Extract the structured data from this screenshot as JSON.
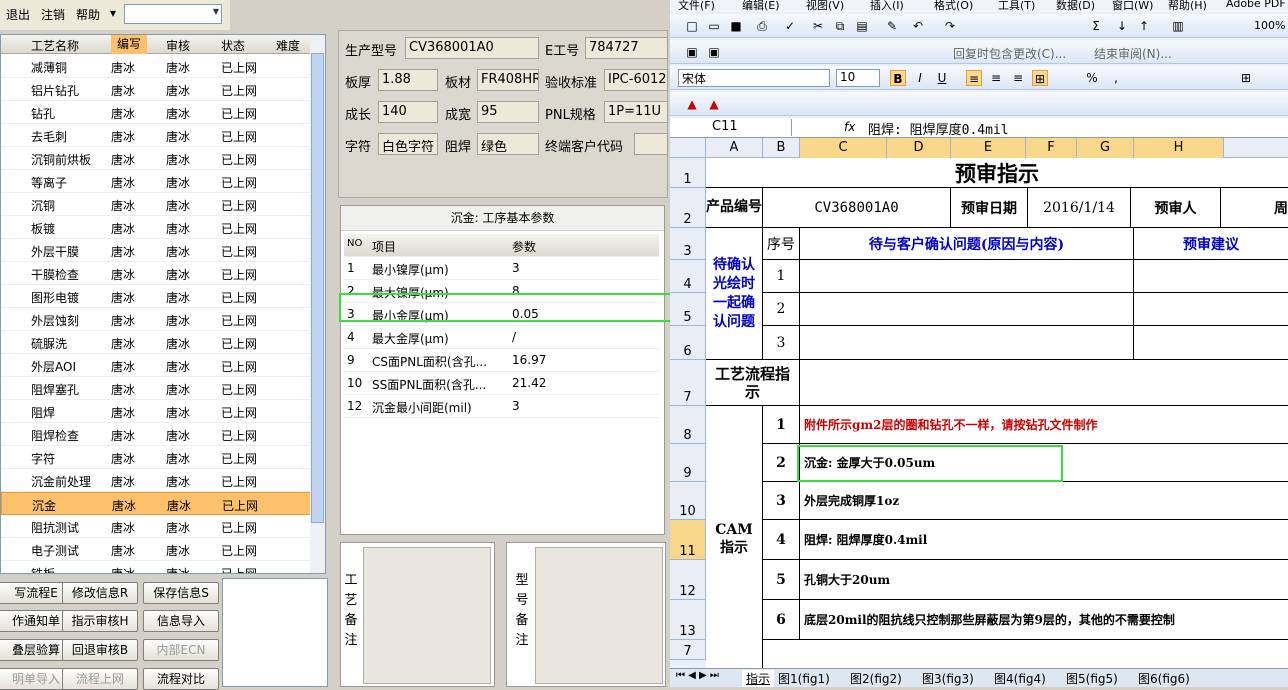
{
  "menubar": {
    "exit": "退出",
    "logout": "注销",
    "help": "帮助",
    "help_arrow": "▾"
  },
  "process_table": {
    "headers": [
      "工艺名称",
      "编写",
      "审核",
      "状态",
      "难度"
    ],
    "rows": [
      [
        "减薄铜",
        "唐冰",
        "唐冰",
        "已上网",
        ""
      ],
      [
        "铝片钻孔",
        "唐冰",
        "唐冰",
        "已上网",
        ""
      ],
      [
        "钻孔",
        "唐冰",
        "唐冰",
        "已上网",
        ""
      ],
      [
        "去毛刺",
        "唐冰",
        "唐冰",
        "已上网",
        ""
      ],
      [
        "沉铜前烘板",
        "唐冰",
        "唐冰",
        "已上网",
        ""
      ],
      [
        "等离子",
        "唐冰",
        "唐冰",
        "已上网",
        ""
      ],
      [
        "沉铜",
        "唐冰",
        "唐冰",
        "已上网",
        ""
      ],
      [
        "板镀",
        "唐冰",
        "唐冰",
        "已上网",
        ""
      ],
      [
        "外层干膜",
        "唐冰",
        "唐冰",
        "已上网",
        ""
      ],
      [
        "干膜检查",
        "唐冰",
        "唐冰",
        "已上网",
        ""
      ],
      [
        "图形电镀",
        "唐冰",
        "唐冰",
        "已上网",
        ""
      ],
      [
        "外层蚀刻",
        "唐冰",
        "唐冰",
        "已上网",
        ""
      ],
      [
        "硫脲洗",
        "唐冰",
        "唐冰",
        "已上网",
        ""
      ],
      [
        "外层AOI",
        "唐冰",
        "唐冰",
        "已上网",
        ""
      ],
      [
        "阻焊塞孔",
        "唐冰",
        "唐冰",
        "已上网",
        ""
      ],
      [
        "阻焊",
        "唐冰",
        "唐冰",
        "已上网",
        ""
      ],
      [
        "阻焊检查",
        "唐冰",
        "唐冰",
        "已上网",
        ""
      ],
      [
        "字符",
        "唐冰",
        "唐冰",
        "已上网",
        ""
      ],
      [
        "沉金前处理",
        "唐冰",
        "唐冰",
        "已上网",
        ""
      ],
      [
        "沉金",
        "唐冰",
        "唐冰",
        "已上网",
        ""
      ],
      [
        "阻抗测试",
        "唐冰",
        "唐冰",
        "已上网",
        ""
      ],
      [
        "电子测试",
        "唐冰",
        "唐冰",
        "已上网",
        ""
      ],
      [
        "铣板",
        "唐冰",
        "唐冰",
        "已上网",
        ""
      ]
    ],
    "selected_index": 19
  },
  "buttons": {
    "write_info": "写流程E",
    "modify_info": "修改信息R",
    "save_info": "保存信息S",
    "make_notice": "作通知单",
    "instruct_review": "指示审核H",
    "info_import": "信息导入",
    "layer_check": "叠层验算",
    "return_review": "回退审核B",
    "internal_ecn": "内部ECN",
    "list_import": "明单导入",
    "flow_online": "流程上网",
    "flow_compare": "流程对比"
  },
  "product": {
    "model_label": "生产型号",
    "model": "CV368001A0",
    "e_label": "E工号",
    "e_no": "784727",
    "thick_label": "板厚",
    "thick": "1.88",
    "material_label": "板材",
    "material": "FR408HR",
    "std_label": "验收标准",
    "std": "IPC-6012",
    "len_label": "成长",
    "len": "140",
    "wid_label": "成宽",
    "wid": "95",
    "pnl_label": "PNL规格",
    "pnl": "1P=11U",
    "char_label": "字符",
    "char": "白色字符",
    "mask_label": "阻焊",
    "mask": "绿色",
    "cust_label": "终端客户代码",
    "cust": ""
  },
  "params": {
    "title": "沉金: 工序基本参数",
    "headers": [
      "NO",
      "项目",
      "参数"
    ],
    "rows": [
      [
        "1",
        "最小镍厚(μm)",
        "3"
      ],
      [
        "2",
        "最大镍厚(μm)",
        "8"
      ],
      [
        "3",
        "最小金厚(μm)",
        "0.05"
      ],
      [
        "4",
        "最大金厚(μm)",
        "/"
      ],
      [
        "9",
        "CS面PNL面积(含孔...",
        "16.97"
      ],
      [
        "10",
        "SS面PNL面积(含孔...",
        "21.42"
      ],
      [
        "12",
        "沉金最小间距(mil)",
        "3"
      ]
    ]
  },
  "notes": {
    "process_note": "工艺备注",
    "model_note": "型号备注"
  },
  "excel": {
    "menu": [
      "文件(F)",
      "编辑(E)",
      "视图(V)",
      "插入(I)",
      "格式(O)",
      "工具(T)",
      "数据(D)",
      "窗口(W)",
      "帮助(H)",
      "Adobe PDF"
    ],
    "font": "宋体",
    "size": "10",
    "zoom": "100%",
    "review_text": "回复时包含更改(C)...",
    "end_review": "结束审阅(N)...",
    "cell_ref": "C11",
    "fx": "fx",
    "formula": "阻焊: 阻焊厚度0.4mil",
    "cols": [
      "A",
      "B",
      "C",
      "D",
      "E",
      "F",
      "G",
      "H"
    ],
    "rows": [
      "1",
      "2",
      "3",
      "4",
      "5",
      "6",
      "7",
      "8",
      "9",
      "10",
      "11",
      "12",
      "13",
      "7"
    ],
    "title": "预审指示",
    "product_no_label": "产品编号",
    "product_no": "CV368001A0",
    "review_date_label": "预审日期",
    "review_date": "2016/1/14",
    "reviewer_label": "预审人",
    "reviewer": "周",
    "seq_label": "序号",
    "issue_header": "待与客户确认问题(原因与内容)",
    "suggest_header": "预审建议",
    "pending_label": "待确认光绘时一起确认问题",
    "issue_nums": [
      "1",
      "2",
      "3"
    ],
    "process_flow_label": "工艺流程指示",
    "cam_label": "CAM指示",
    "cam_items": [
      {
        "n": "1",
        "text": "附件所示gm2层的圈和钻孔不一样，请按钻孔文件制作",
        "red": true
      },
      {
        "n": "2",
        "text": "沉金: 金厚大于0.05um",
        "red": false
      },
      {
        "n": "3",
        "text": "外层完成铜厚1oz",
        "red": false
      },
      {
        "n": "4",
        "text": "阻焊: 阻焊厚度0.4mil",
        "red": false
      },
      {
        "n": "5",
        "text": "孔铜大于20um",
        "red": false
      },
      {
        "n": "6",
        "text": "底层20mil的阻抗线只控制那些屏蔽层为第9层的，其他的不需要控制",
        "red": false
      }
    ],
    "tabs": [
      "指示",
      "图1(fig1)",
      "图2(fig2)",
      "图3(fig3)",
      "图4(fig4)",
      "图5(fig5)",
      "图6(fig6)"
    ]
  }
}
